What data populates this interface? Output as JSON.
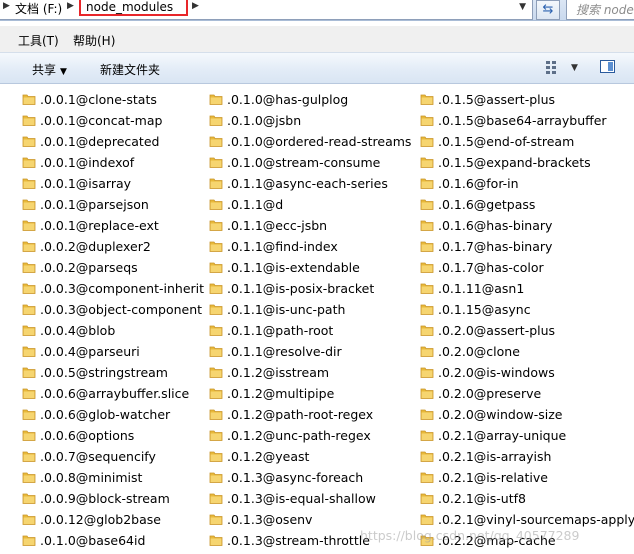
{
  "address": {
    "root": "文档 (F:)",
    "current": "node_modules"
  },
  "search": {
    "placeholder": "搜索 node"
  },
  "menu": {
    "tools": "工具(T)",
    "help": "帮助(H)"
  },
  "commands": {
    "share": "共享",
    "new_folder": "新建文件夹"
  },
  "icons": {
    "folder": "folder-icon",
    "refresh": "refresh-icon",
    "view": "view-options-icon",
    "pane": "preview-pane-icon",
    "folder_color": "#e8b93a"
  },
  "files": {
    "col1": [
      ".0.0.1@clone-stats",
      ".0.0.1@concat-map",
      ".0.0.1@deprecated",
      ".0.0.1@indexof",
      ".0.0.1@isarray",
      ".0.0.1@parsejson",
      ".0.0.1@replace-ext",
      ".0.0.2@duplexer2",
      ".0.0.2@parseqs",
      ".0.0.3@component-inherit",
      ".0.0.3@object-component",
      ".0.0.4@blob",
      ".0.0.4@parseuri",
      ".0.0.5@stringstream",
      ".0.0.6@arraybuffer.slice",
      ".0.0.6@glob-watcher",
      ".0.0.6@options",
      ".0.0.7@sequencify",
      ".0.0.8@minimist",
      ".0.0.9@block-stream",
      ".0.0.12@glob2base",
      ".0.1.0@base64id"
    ],
    "col2": [
      ".0.1.0@has-gulplog",
      ".0.1.0@jsbn",
      ".0.1.0@ordered-read-streams",
      ".0.1.0@stream-consume",
      ".0.1.1@async-each-series",
      ".0.1.1@d",
      ".0.1.1@ecc-jsbn",
      ".0.1.1@find-index",
      ".0.1.1@is-extendable",
      ".0.1.1@is-posix-bracket",
      ".0.1.1@is-unc-path",
      ".0.1.1@path-root",
      ".0.1.1@resolve-dir",
      ".0.1.2@isstream",
      ".0.1.2@multipipe",
      ".0.1.2@path-root-regex",
      ".0.1.2@unc-path-regex",
      ".0.1.2@yeast",
      ".0.1.3@async-foreach",
      ".0.1.3@is-equal-shallow",
      ".0.1.3@osenv",
      ".0.1.3@stream-throttle"
    ],
    "col3": [
      ".0.1.5@assert-plus",
      ".0.1.5@base64-arraybuffer",
      ".0.1.5@end-of-stream",
      ".0.1.5@expand-brackets",
      ".0.1.6@for-in",
      ".0.1.6@getpass",
      ".0.1.6@has-binary",
      ".0.1.7@has-binary",
      ".0.1.7@has-color",
      ".0.1.11@asn1",
      ".0.1.15@async",
      ".0.2.0@assert-plus",
      ".0.2.0@clone",
      ".0.2.0@is-windows",
      ".0.2.0@preserve",
      ".0.2.0@window-size",
      ".0.2.1@array-unique",
      ".0.2.1@is-arrayish",
      ".0.2.1@is-relative",
      ".0.2.1@is-utf8",
      ".0.2.1@vinyl-sourcemaps-apply",
      ".0.2.2@map-cache"
    ]
  },
  "watermark": "https://blog.csdn.net/qq_40577289"
}
